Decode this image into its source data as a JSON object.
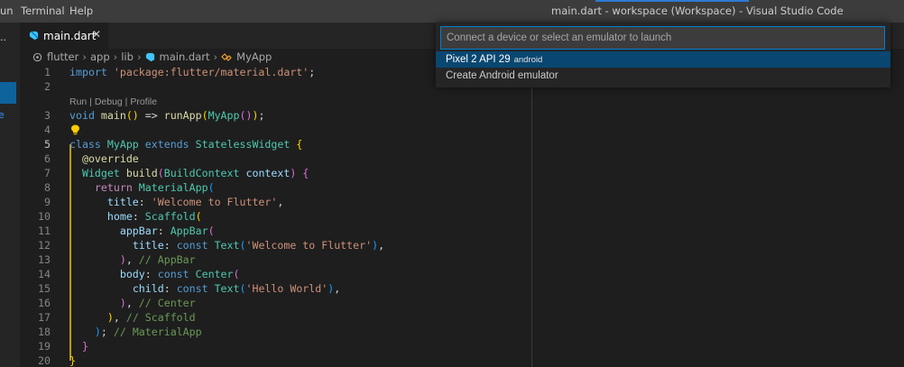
{
  "titlebar": {
    "menu": [
      "un",
      "Terminal",
      "Help"
    ],
    "title": "main.dart - workspace (Workspace) - Visual Studio Code"
  },
  "activitybar": {
    "partial_label": "..",
    "partial_letter": "e"
  },
  "tab": {
    "label": "main.dart",
    "close": "✕"
  },
  "breadcrumb": {
    "items": [
      "flutter",
      "app",
      "lib",
      "main.dart",
      "MyApp"
    ]
  },
  "quickpick": {
    "placeholder": "Connect a device or select an emulator to launch",
    "items": [
      {
        "label": "Pixel 2 API 29",
        "description": "android"
      },
      {
        "label": "Create Android emulator",
        "description": ""
      }
    ]
  },
  "editor": {
    "codelens": "Run | Debug | Profile",
    "lines": [
      {
        "n": "1",
        "tokens": [
          [
            "kw",
            "import"
          ],
          [
            "pun",
            " "
          ],
          [
            "str",
            "'package:flutter/material.dart'"
          ],
          [
            "pun",
            ";"
          ]
        ]
      },
      {
        "n": "2",
        "tokens": []
      },
      {
        "n": "3",
        "tokens": [
          [
            "kw",
            "void"
          ],
          [
            "pun",
            " "
          ],
          [
            "fn",
            "main"
          ],
          [
            "br1",
            "()"
          ],
          [
            "pun",
            " => "
          ],
          [
            "fn",
            "runApp"
          ],
          [
            "br1",
            "("
          ],
          [
            "cls",
            "MyApp"
          ],
          [
            "br2",
            "()"
          ],
          [
            "br1",
            ")"
          ],
          [
            "pun",
            ";"
          ]
        ]
      },
      {
        "n": "4",
        "tokens": []
      },
      {
        "n": "5",
        "tokens": [
          [
            "kw",
            "class"
          ],
          [
            "pun",
            " "
          ],
          [
            "cls",
            "MyApp"
          ],
          [
            "pun",
            " "
          ],
          [
            "kw",
            "extends"
          ],
          [
            "pun",
            " "
          ],
          [
            "cls",
            "StatelessWidget"
          ],
          [
            "pun",
            " "
          ],
          [
            "br1",
            "{"
          ]
        ]
      },
      {
        "n": "6",
        "tokens": [
          [
            "pun",
            "  "
          ],
          [
            "fn",
            "@override"
          ]
        ]
      },
      {
        "n": "7",
        "tokens": [
          [
            "pun",
            "  "
          ],
          [
            "cls",
            "Widget"
          ],
          [
            "pun",
            " "
          ],
          [
            "fn",
            "build"
          ],
          [
            "br2",
            "("
          ],
          [
            "cls",
            "BuildContext"
          ],
          [
            "pun",
            " "
          ],
          [
            "prm",
            "context"
          ],
          [
            "br2",
            ")"
          ],
          [
            "pun",
            " "
          ],
          [
            "br2",
            "{"
          ]
        ]
      },
      {
        "n": "8",
        "tokens": [
          [
            "pun",
            "    "
          ],
          [
            "kw2",
            "return"
          ],
          [
            "pun",
            " "
          ],
          [
            "cls",
            "MaterialApp"
          ],
          [
            "br3",
            "("
          ]
        ]
      },
      {
        "n": "9",
        "tokens": [
          [
            "pun",
            "      "
          ],
          [
            "prm",
            "title"
          ],
          [
            "pun",
            ": "
          ],
          [
            "str",
            "'Welcome to Flutter'"
          ],
          [
            "pun",
            ","
          ]
        ]
      },
      {
        "n": "10",
        "tokens": [
          [
            "pun",
            "      "
          ],
          [
            "prm",
            "home"
          ],
          [
            "pun",
            ": "
          ],
          [
            "cls",
            "Scaffold"
          ],
          [
            "br1",
            "("
          ]
        ]
      },
      {
        "n": "11",
        "tokens": [
          [
            "pun",
            "        "
          ],
          [
            "prm",
            "appBar"
          ],
          [
            "pun",
            ": "
          ],
          [
            "cls",
            "AppBar"
          ],
          [
            "br2",
            "("
          ]
        ]
      },
      {
        "n": "12",
        "tokens": [
          [
            "pun",
            "          "
          ],
          [
            "prm",
            "title"
          ],
          [
            "pun",
            ": "
          ],
          [
            "kw",
            "const"
          ],
          [
            "pun",
            " "
          ],
          [
            "cls",
            "Text"
          ],
          [
            "br3",
            "("
          ],
          [
            "str",
            "'Welcome to Flutter'"
          ],
          [
            "br3",
            ")"
          ],
          [
            "pun",
            ","
          ]
        ]
      },
      {
        "n": "13",
        "tokens": [
          [
            "pun",
            "        "
          ],
          [
            "br2",
            ")"
          ],
          [
            "pun",
            ", "
          ],
          [
            "cmt",
            "// AppBar"
          ]
        ]
      },
      {
        "n": "14",
        "tokens": [
          [
            "pun",
            "        "
          ],
          [
            "prm",
            "body"
          ],
          [
            "pun",
            ": "
          ],
          [
            "kw",
            "const"
          ],
          [
            "pun",
            " "
          ],
          [
            "cls",
            "Center"
          ],
          [
            "br2",
            "("
          ]
        ]
      },
      {
        "n": "15",
        "tokens": [
          [
            "pun",
            "          "
          ],
          [
            "prm",
            "child"
          ],
          [
            "pun",
            ": "
          ],
          [
            "kw",
            "const"
          ],
          [
            "pun",
            " "
          ],
          [
            "cls",
            "Text"
          ],
          [
            "br3",
            "("
          ],
          [
            "str",
            "'Hello World'"
          ],
          [
            "br3",
            ")"
          ],
          [
            "pun",
            ","
          ]
        ]
      },
      {
        "n": "16",
        "tokens": [
          [
            "pun",
            "        "
          ],
          [
            "br2",
            ")"
          ],
          [
            "pun",
            ", "
          ],
          [
            "cmt",
            "// Center"
          ]
        ]
      },
      {
        "n": "17",
        "tokens": [
          [
            "pun",
            "      "
          ],
          [
            "br1",
            ")"
          ],
          [
            "pun",
            ", "
          ],
          [
            "cmt",
            "// Scaffold"
          ]
        ]
      },
      {
        "n": "18",
        "tokens": [
          [
            "pun",
            "    "
          ],
          [
            "br3",
            ")"
          ],
          [
            "pun",
            "; "
          ],
          [
            "cmt",
            "// MaterialApp"
          ]
        ]
      },
      {
        "n": "19",
        "tokens": [
          [
            "pun",
            "  "
          ],
          [
            "br2",
            "}"
          ]
        ]
      },
      {
        "n": "20",
        "tokens": [
          [
            "br1",
            "}"
          ]
        ]
      }
    ]
  },
  "colors": {
    "selection": "#094771",
    "focus_border": "#007fd4",
    "editor_bg": "#1e1e1e",
    "titlebar_bg": "#3c3c3c"
  }
}
